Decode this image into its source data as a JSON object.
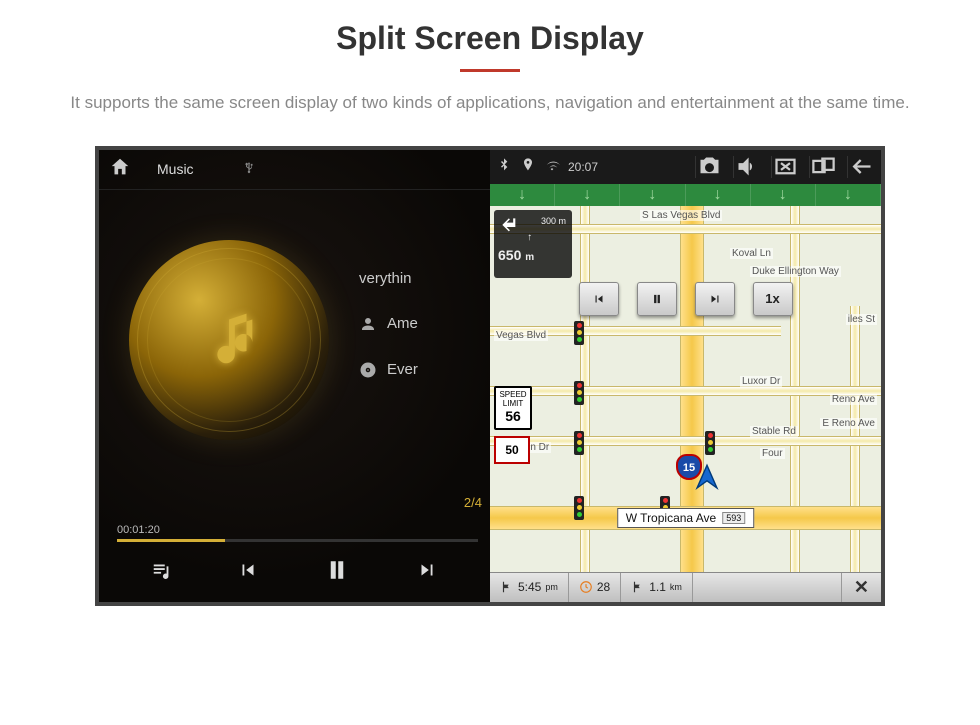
{
  "page": {
    "title": "Split Screen Display",
    "description": "It supports the same screen display of two kinds of applications, navigation and entertainment at the same time."
  },
  "music": {
    "header_label": "Music",
    "song_title": "verythin",
    "artist": "Ame",
    "album": "Ever",
    "track_counter": "2/4",
    "elapsed": "00:01:20"
  },
  "status": {
    "time": "20:07"
  },
  "nav": {
    "turn_dist_sub": "300 m",
    "turn_dist_main": "650",
    "turn_unit": "m",
    "speed_limit_label": "SPEED LIMIT",
    "speed_limit_value": "56",
    "route_shield": "50",
    "interstate": "15",
    "speed_btn": "1x",
    "streets": {
      "s_las_vegas": "S Las Vegas Blvd",
      "koval": "Koval Ln",
      "duke": "Duke Ellington Way",
      "ali": "iles St",
      "vegas_blvd": "Vegas Blvd",
      "luxor": "Luxor Dr",
      "reno_short": "Reno Ave",
      "e_reno": "E Reno Ave",
      "stable": "Stable Rd",
      "four": "Four",
      "martin": "rtin Dr",
      "tropicana": "W Tropicana Ave",
      "tropicana_badge": "593"
    },
    "footer": {
      "eta": "5:45",
      "eta_period": "pm",
      "time_remaining": "28",
      "dist_remaining": "1.1",
      "dist_unit": "km"
    }
  }
}
